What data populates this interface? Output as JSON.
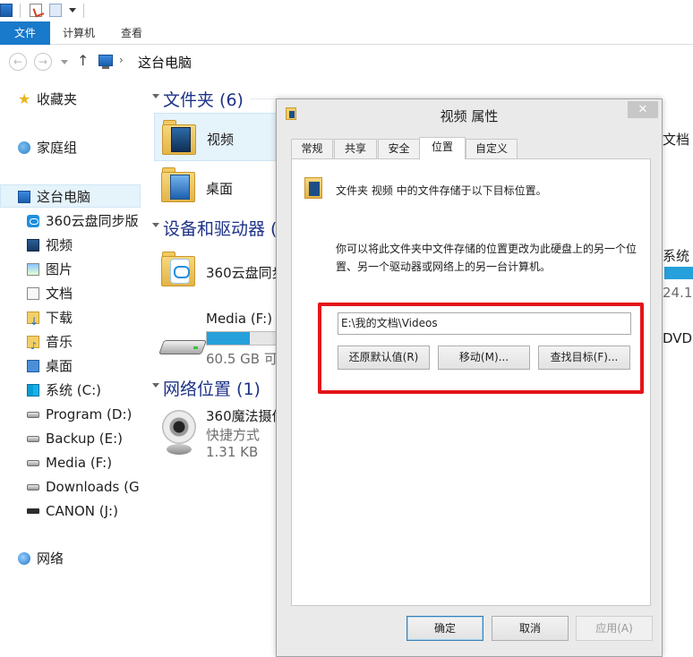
{
  "ribbon": {
    "tabs": [
      {
        "label": "文件"
      },
      {
        "label": "计算机"
      },
      {
        "label": "查看"
      }
    ]
  },
  "address": {
    "path": "这台电脑"
  },
  "nav": {
    "items": [
      {
        "label": "收藏夹",
        "icon": "star-icon"
      },
      {
        "label": "家庭组",
        "icon": "homegroup-icon"
      },
      {
        "label": "这台电脑",
        "icon": "computer-icon",
        "selected": true
      },
      {
        "label": "360云盘同步版",
        "icon": "cloud-icon"
      },
      {
        "label": "视频",
        "icon": "video-folder-icon"
      },
      {
        "label": "图片",
        "icon": "pictures-folder-icon"
      },
      {
        "label": "文档",
        "icon": "documents-folder-icon"
      },
      {
        "label": "下载",
        "icon": "downloads-folder-icon"
      },
      {
        "label": "音乐",
        "icon": "music-folder-icon"
      },
      {
        "label": "桌面",
        "icon": "desktop-folder-icon"
      },
      {
        "label": "系统 (C:)",
        "icon": "system-drive-icon"
      },
      {
        "label": "Program (D:)",
        "icon": "drive-icon"
      },
      {
        "label": "Backup (E:)",
        "icon": "drive-icon"
      },
      {
        "label": "Media (F:)",
        "icon": "drive-icon"
      },
      {
        "label": "Downloads (G",
        "icon": "drive-icon"
      },
      {
        "label": "CANON (J:)",
        "icon": "usb-drive-icon"
      },
      {
        "label": "网络",
        "icon": "network-icon"
      }
    ]
  },
  "main": {
    "groups": {
      "folders": "文件夹 (6)",
      "devices": "设备和驱动器 (",
      "network": "网络位置 (1)"
    },
    "folders": [
      {
        "label": "视频"
      },
      {
        "label": "桌面"
      }
    ],
    "devices": [
      {
        "label": "360云盘同步"
      },
      {
        "label": "Media (F:)",
        "free": "60.5 GB 可",
        "used_fraction": 0.55
      }
    ],
    "network": [
      {
        "label": "360魔法摄像",
        "type": "快捷方式",
        "size": "1.31 KB"
      }
    ],
    "right_partial": {
      "doc": "文档",
      "system": "系统",
      "size": "24.1",
      "dvd": "DVD"
    }
  },
  "dialog": {
    "title": "视频 属性",
    "close": "✕",
    "tabs": [
      "常规",
      "共享",
      "安全",
      "位置",
      "自定义"
    ],
    "active_tab": "位置",
    "info": "文件夹 视频 中的文件存储于以下目标位置。",
    "description": "你可以将此文件夹中文件存储的位置更改为此硬盘上的另一个位置、另一个驱动器或网络上的另一台计算机。",
    "path": "E:\\我的文档\\Videos",
    "buttons": {
      "restore": "还原默认值(R)",
      "move": "移动(M)...",
      "find": "查找目标(F)..."
    },
    "footer": {
      "ok": "确定",
      "cancel": "取消",
      "apply": "应用(A)"
    }
  },
  "colors": {
    "accent": "#1979ca",
    "group_header": "#1e3287",
    "capacity": "#26a0da",
    "highlight": "#e3141a"
  }
}
